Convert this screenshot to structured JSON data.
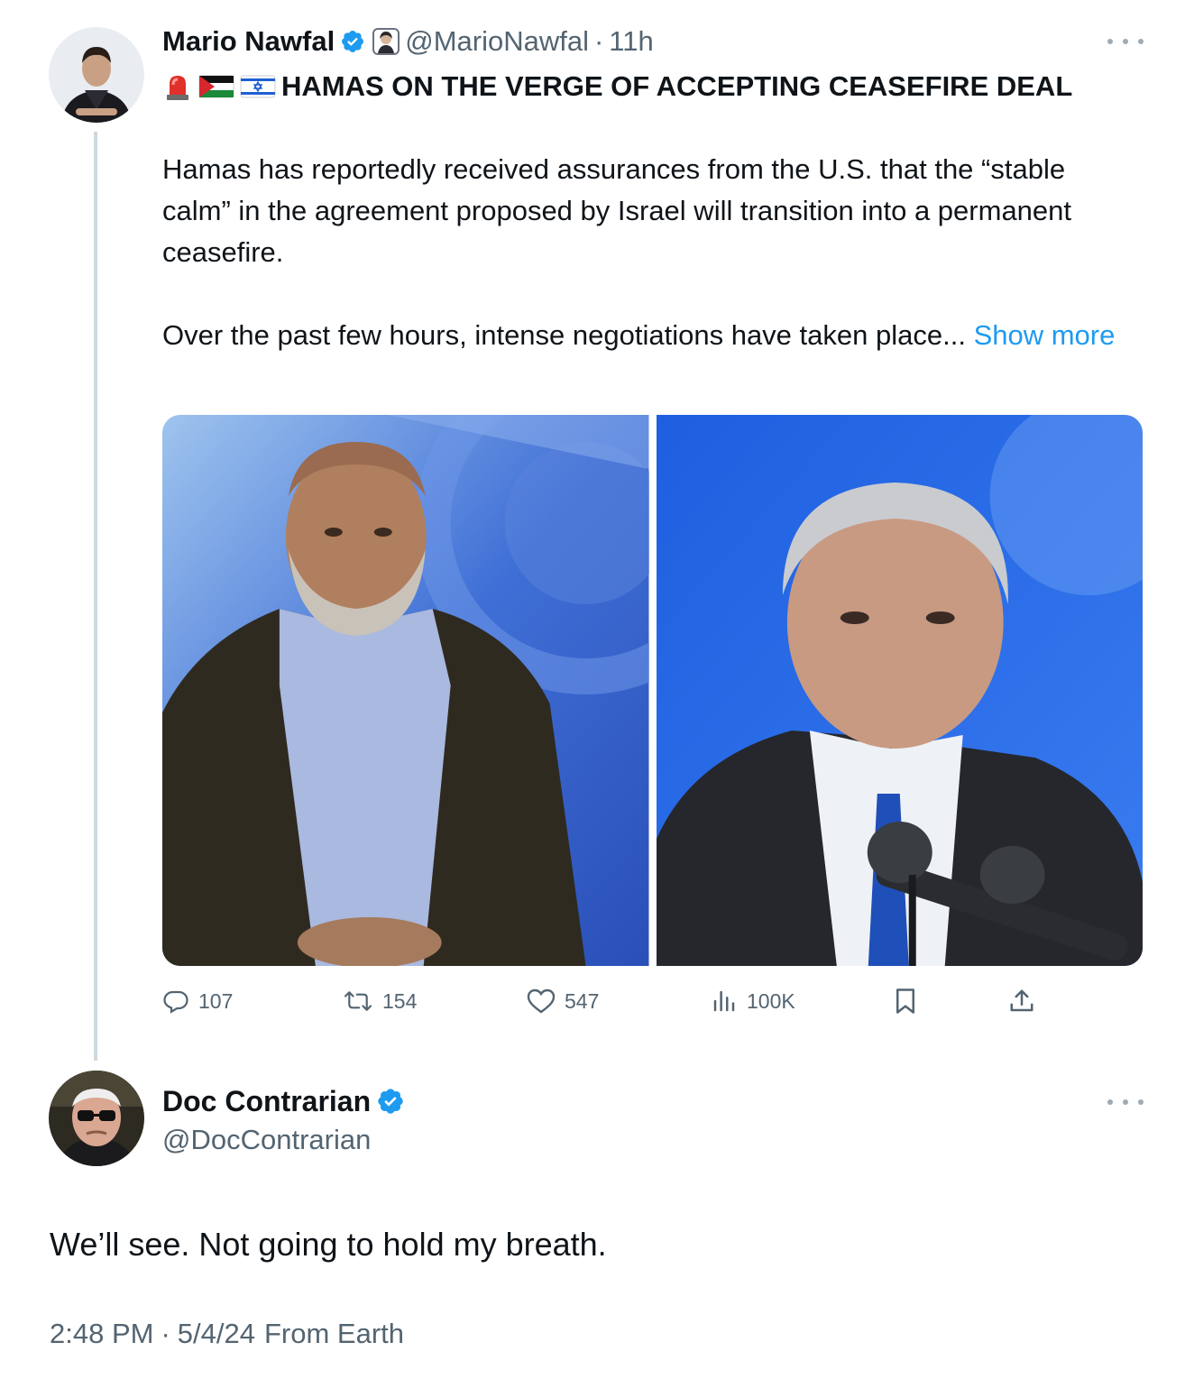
{
  "tweet": {
    "author": {
      "display_name": "Mario Nawfal",
      "handle": "@MarioNawfal",
      "verified": true
    },
    "separator": "·",
    "time_ago": "11h",
    "headline": "HAMAS ON THE VERGE OF ACCEPTING CEASEFIRE DEAL",
    "body_paragraph_1": "Hamas has reportedly received assurances from the U.S. that the “stable calm” in the agreement proposed by Israel will transition into a permanent ceasefire.",
    "body_paragraph_2": "Over the past few hours, intense negotiations have taken place...",
    "show_more_label": "Show more",
    "metrics": {
      "replies": "107",
      "reposts": "154",
      "likes": "547",
      "views": "100K"
    },
    "icons": [
      "reply-icon",
      "repost-icon",
      "like-icon",
      "views-icon",
      "bookmark-icon",
      "share-icon"
    ]
  },
  "reply": {
    "author": {
      "display_name": "Doc Contrarian",
      "handle": "@DocContrarian",
      "verified": true
    },
    "text": "We’ll see. Not going to hold my breath.",
    "time": "2:48 PM",
    "separator": "·",
    "date": "5/4/24",
    "source": "From Earth"
  },
  "colors": {
    "text_primary": "#0f1419",
    "text_secondary": "#536471",
    "link": "#1d9bf0",
    "verified": "#1d9bf0",
    "thread_line": "#cfd9de"
  }
}
